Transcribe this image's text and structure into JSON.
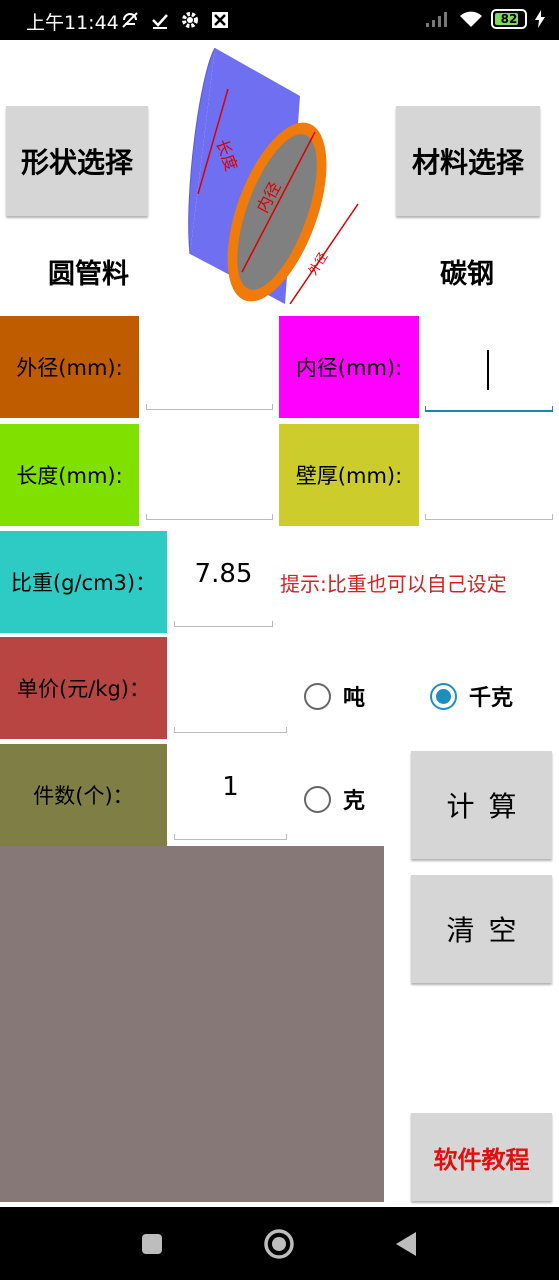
{
  "status_bar": {
    "time": "上午11:44",
    "battery": "82",
    "icons": [
      "mute-alarm-icon",
      "check-icon",
      "settings-icon",
      "app-icon",
      "signal-icon",
      "wifi-icon",
      "battery-icon",
      "charging-icon"
    ]
  },
  "header": {
    "shape_button": "形状选择",
    "material_button": "材料选择",
    "shape_value": "圆管料",
    "material_value": "碳钢",
    "diagram": {
      "length_label": "长度",
      "inner_label": "内径",
      "outer_label": "外径"
    }
  },
  "fields": {
    "outer_diameter": {
      "label": "外径(mm):",
      "value": "",
      "color": "#bf5c00"
    },
    "inner_diameter": {
      "label": "内径(mm):",
      "value": "",
      "color": "#ff00ff"
    },
    "length": {
      "label": "长度(mm):",
      "value": "",
      "color": "#80e000"
    },
    "wall_thickness": {
      "label": "壁厚(mm):",
      "value": "",
      "color": "#cccc2c"
    },
    "density": {
      "label": "比重(g/cm3)：",
      "value": "7.85",
      "color": "#2ecbc4"
    },
    "unit_price": {
      "label": "单价(元/kg)：",
      "value": "",
      "color": "#b94542"
    },
    "quantity": {
      "label": "件数(个)：",
      "value": "1",
      "color": "#7f7f45"
    }
  },
  "hint": "提示:比重也可以自己设定",
  "units": {
    "ton": "吨",
    "kilogram": "千克",
    "gram": "克",
    "selected": "kilogram"
  },
  "actions": {
    "calculate": "计算",
    "clear": "清空",
    "tutorial": "软件教程"
  },
  "colors": {
    "result_area": "#857876",
    "hint": "#d22222",
    "tutorial_text": "#e01010",
    "radio_accent": "#1c8fc0"
  }
}
